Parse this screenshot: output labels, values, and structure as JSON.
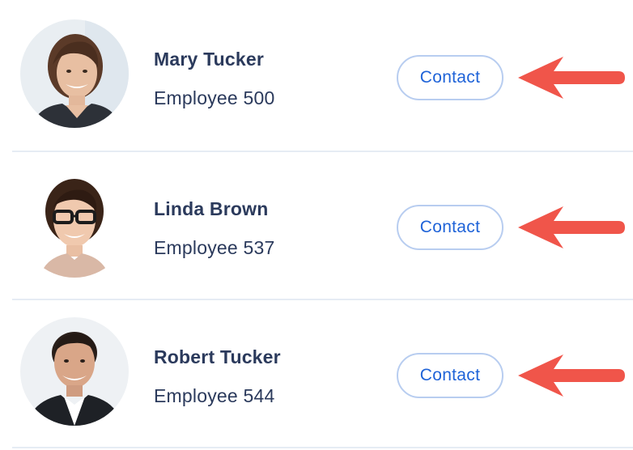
{
  "employees": [
    {
      "name": "Mary Tucker",
      "subtitle": "Employee 500",
      "contact_label": "Contact",
      "avatar_icon": "avatar-woman-short-hair"
    },
    {
      "name": "Linda Brown",
      "subtitle": "Employee 537",
      "contact_label": "Contact",
      "avatar_icon": "avatar-woman-glasses"
    },
    {
      "name": "Robert Tucker",
      "subtitle": "Employee 544",
      "contact_label": "Contact",
      "avatar_icon": "avatar-man-suit"
    }
  ],
  "colors": {
    "name_text": "#2b3a5c",
    "button_text": "#1f63d8",
    "button_border": "#b8cdf0",
    "arrow": "#f0554a",
    "divider": "#e6ecf4"
  },
  "annotations": {
    "arrow_icon": "red-left-arrow-icon"
  }
}
